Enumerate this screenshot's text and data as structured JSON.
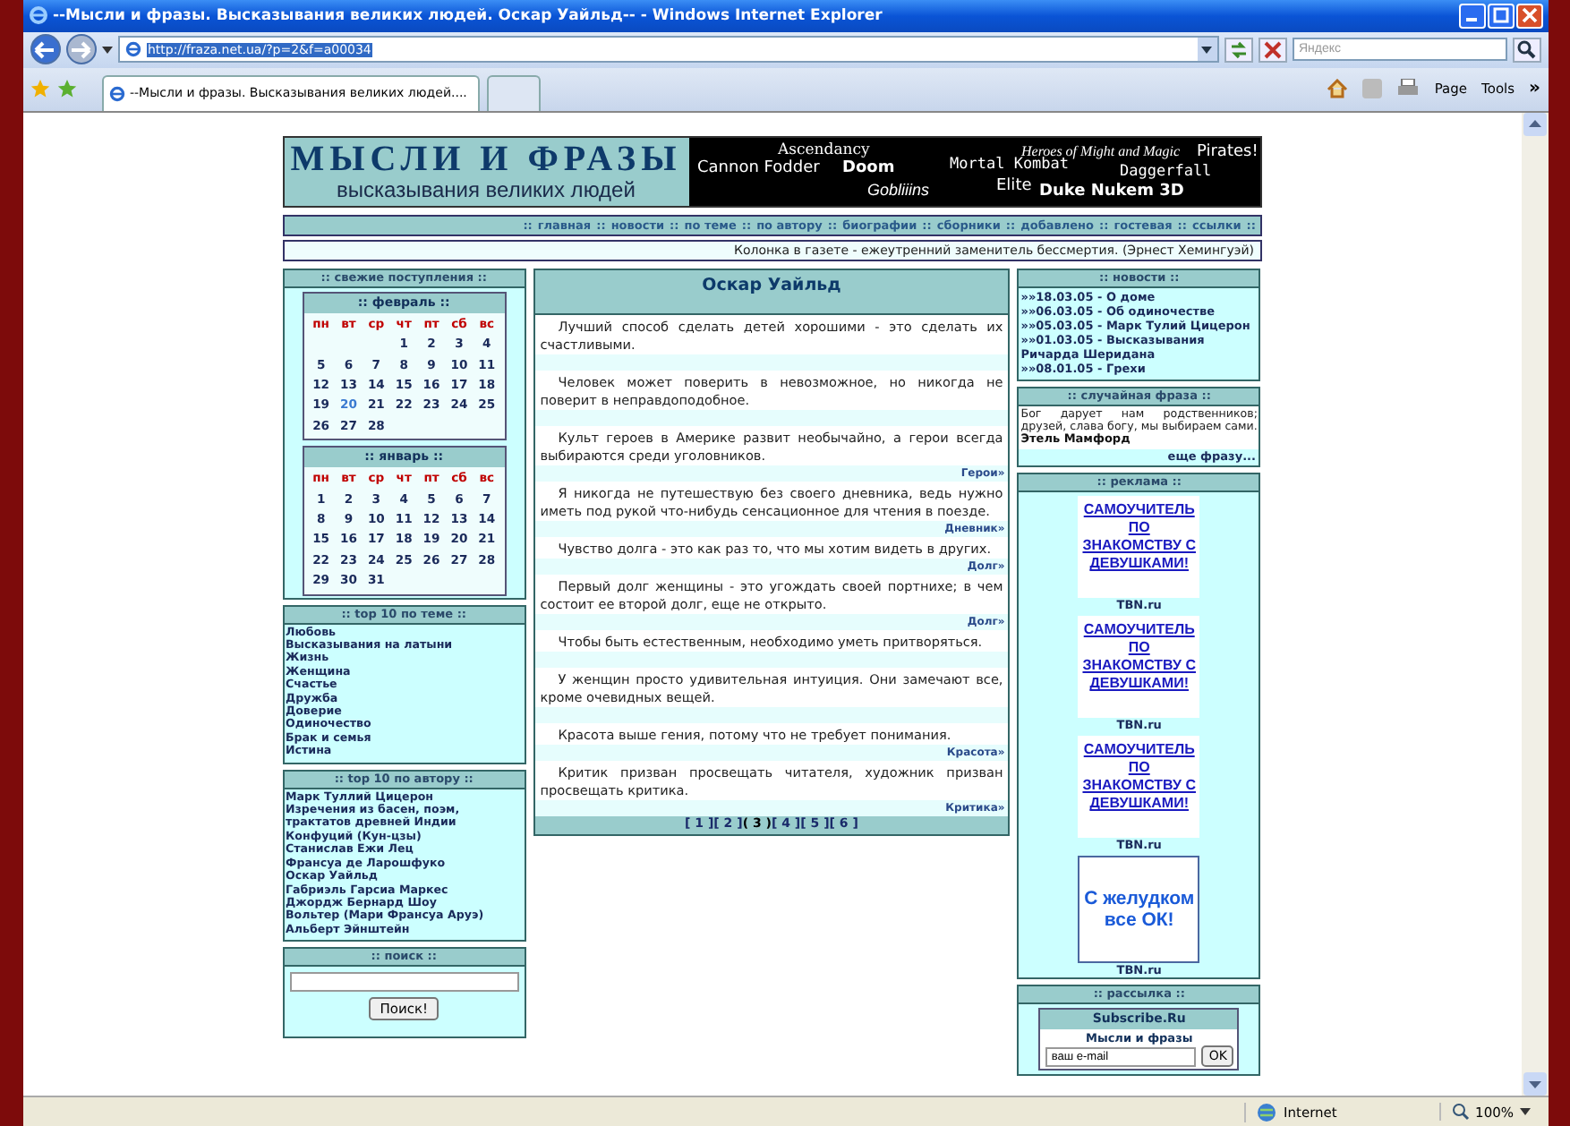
{
  "browser": {
    "title": "--Мысли и фразы. Высказывания великих людей. Оскар Уайльд-- - Windows Internet Explorer",
    "url": "http://fraza.net.ua/?p=2&f=a00034",
    "search_placeholder": "Яндекс",
    "tab_title": "--Мысли и фразы. Высказывания великих людей....",
    "menu": [
      "Page",
      "Tools"
    ],
    "overflow": "»"
  },
  "header": {
    "logo_title": "МЫСЛИ И ФРАЗЫ",
    "logo_subtitle": "высказывания великих людей",
    "games": [
      {
        "label": "Ascendancy",
        "kind": "serif"
      },
      {
        "label": "Heroes of Might and Magic",
        "kind": "serif-italic"
      },
      {
        "label": "Pirates!",
        "kind": "sans"
      },
      {
        "label": "Cannon Fodder",
        "kind": "sans"
      },
      {
        "label": "Doom",
        "kind": "bold"
      },
      {
        "label": "Mortal Kombat",
        "kind": "mono"
      },
      {
        "label": "Daggerfall",
        "kind": "mono"
      },
      {
        "label": "Gobliiins",
        "kind": "italic"
      },
      {
        "label": "Elite",
        "kind": "sans"
      },
      {
        "label": "Duke Nukem 3D",
        "kind": "bold"
      }
    ]
  },
  "nav": {
    "separator": "::",
    "links": [
      "главная",
      "новости",
      "по теме",
      "по автору",
      "биографии",
      "сборники",
      "добавлено",
      "гостевая",
      "ссылки"
    ]
  },
  "quote_bar": "Колонка в газете - ежеутренний заменитель бессмертия. (Эрнест Хемингуэй)",
  "left": {
    "fresh": {
      "title": ":: свежие поступления ::",
      "months": [
        {
          "title": ":: февраль ::",
          "weekdays": [
            "пн",
            "вт",
            "ср",
            "чт",
            "пт",
            "сб",
            "вс"
          ],
          "weeks": [
            [
              {
                "d": "1",
                "today": false
              },
              {
                "d": "2",
                "today": false
              },
              {
                "d": "3",
                "today": false
              },
              {
                "d": "4",
                "today": false
              }
            ],
            [
              {
                "d": "5",
                "today": false
              },
              {
                "d": "6",
                "today": false
              },
              {
                "d": "7",
                "today": false
              },
              {
                "d": "8",
                "today": false
              },
              {
                "d": "9",
                "today": false
              },
              {
                "d": "10",
                "today": false
              },
              {
                "d": "11",
                "today": false
              }
            ],
            [
              {
                "d": "12",
                "today": false
              },
              {
                "d": "13",
                "today": false
              },
              {
                "d": "14",
                "today": false
              },
              {
                "d": "15",
                "today": false
              },
              {
                "d": "16",
                "today": false
              },
              {
                "d": "17",
                "today": false
              },
              {
                "d": "18",
                "today": false
              }
            ],
            [
              {
                "d": "19",
                "today": false
              },
              {
                "d": "20",
                "today": true
              },
              {
                "d": "21",
                "today": false
              },
              {
                "d": "22",
                "today": false
              },
              {
                "d": "23",
                "today": false
              },
              {
                "d": "24",
                "today": false
              },
              {
                "d": "25",
                "today": false
              }
            ],
            [
              {
                "d": "26",
                "today": false
              },
              {
                "d": "27",
                "today": false
              },
              {
                "d": "28",
                "today": false
              }
            ]
          ]
        },
        {
          "title": ":: январь ::",
          "weekdays": [
            "пн",
            "вт",
            "ср",
            "чт",
            "пт",
            "сб",
            "вс"
          ],
          "weeks": [
            [
              {
                "d": "1",
                "today": false
              },
              {
                "d": "2",
                "today": false
              },
              {
                "d": "3",
                "today": false
              },
              {
                "d": "4",
                "today": false
              },
              {
                "d": "5",
                "today": false
              },
              {
                "d": "6",
                "today": false
              },
              {
                "d": "7",
                "today": false
              }
            ],
            [
              {
                "d": "8",
                "today": false
              },
              {
                "d": "9",
                "today": false
              },
              {
                "d": "10",
                "today": false
              },
              {
                "d": "11",
                "today": false
              },
              {
                "d": "12",
                "today": false
              },
              {
                "d": "13",
                "today": false
              },
              {
                "d": "14",
                "today": false
              }
            ],
            [
              {
                "d": "15",
                "today": false
              },
              {
                "d": "16",
                "today": false
              },
              {
                "d": "17",
                "today": false
              },
              {
                "d": "18",
                "today": false
              },
              {
                "d": "19",
                "today": false
              },
              {
                "d": "20",
                "today": false
              },
              {
                "d": "21",
                "today": false
              }
            ],
            [
              {
                "d": "22",
                "today": false
              },
              {
                "d": "23",
                "today": false
              },
              {
                "d": "24",
                "today": false
              },
              {
                "d": "25",
                "today": false
              },
              {
                "d": "26",
                "today": false
              },
              {
                "d": "27",
                "today": false
              },
              {
                "d": "28",
                "today": false
              }
            ],
            [
              {
                "d": "29",
                "today": false
              },
              {
                "d": "30",
                "today": false
              },
              {
                "d": "31",
                "today": false
              }
            ]
          ]
        }
      ]
    },
    "top_themes": {
      "title": ":: top 10 по теме ::",
      "items": [
        "Любовь",
        "Высказывания на латыни",
        "Жизнь",
        "Женщина",
        "Счастье",
        "Дружба",
        "Доверие",
        "Одиночество",
        "Брак и семья",
        "Истина"
      ]
    },
    "top_authors": {
      "title": ":: top 10 по автору ::",
      "items": [
        "Марк Туллий Цицерон",
        "Изречения из басен, поэм, трактатов древней Индии",
        "Конфуций (Кун-цзы)",
        "Станислав Ежи Лец",
        "Франсуа де Ларошфуко",
        "Оскар Уайльд",
        "Габриэль Гарсиа Маркес",
        "Джордж Бернард Шоу",
        "Вольтер (Мари Франсуа Аруэ)",
        "Альберт Эйнштейн"
      ]
    },
    "search": {
      "title": ":: поиск ::",
      "button": "Поиск!"
    }
  },
  "center": {
    "title": "Оскар Уайльд",
    "quotes": [
      {
        "text": "Лучший способ сделать детей хорошими - это сделать их счастливыми."
      },
      {
        "text": "Человек может поверить в невозможное, но никогда не поверит в неправдоподобное."
      },
      {
        "text": "Культ героев в Америке развит необычайно, а герои всегда выбираются среди уголовников.",
        "tag": "Герои»"
      },
      {
        "text": "Я никогда не путешествую без своего дневника, ведь нужно иметь под рукой что-нибудь сенсационное для чтения в поезде.",
        "tag": "Дневник»"
      },
      {
        "text": "Чувство долга - это как раз то, что мы хотим видеть в других.",
        "tag": "Долг»"
      },
      {
        "text": "Первый долг женщины - это угождать своей портнихе; в чем состоит ее второй долг, еще не открыто.",
        "tag": "Долг»"
      },
      {
        "text": "Чтобы быть естественным, необходимо уметь притворяться."
      },
      {
        "text": "У женщин просто удивительная интуиция. Они замечают все, кроме очевидных вещей."
      },
      {
        "text": "Красота выше гения, потому что не требует понимания.",
        "tag": "Красота»"
      },
      {
        "text": "Критик призван просвещать читателя, художник призван просвещать критика.",
        "tag": "Критика»"
      }
    ],
    "pages": [
      {
        "label": "[ 1 ]",
        "selected": false
      },
      {
        "label": "[ 2 ]",
        "selected": false
      },
      {
        "label": "( 3 )",
        "selected": true
      },
      {
        "label": "[ 4 ]",
        "selected": false
      },
      {
        "label": "[ 5 ]",
        "selected": false
      },
      {
        "label": "[ 6 ]",
        "selected": false
      }
    ]
  },
  "right": {
    "news": {
      "title": ":: новости ::",
      "items": [
        "»»18.03.05 - О доме",
        "»»06.03.05 - Об одиночестве",
        "»»05.03.05 - Марк Тулий Цицерон",
        "»»01.03.05 - Высказывания Ричарда Шеридана",
        "»»08.01.05 - Грехи"
      ]
    },
    "random": {
      "title": ":: случайная фраза ::",
      "text": "Бог дарует нам родственников; друзей, слава богу, мы выбираем сами.",
      "author": "Этель Мамфорд",
      "more": "еще фразу..."
    },
    "ads": {
      "title": ":: реклама ::",
      "items": [
        {
          "kind": "text",
          "text": "САМОУЧИТЕЛЬ ПО ЗНАКОМСТВУ С ДЕВУШКАМИ!",
          "source": "TBN.ru"
        },
        {
          "kind": "text",
          "text": "САМОУЧИТЕЛЬ ПО ЗНАКОМСТВУ С ДЕВУШКАМИ!",
          "source": "TBN.ru"
        },
        {
          "kind": "text",
          "text": "САМОУЧИТЕЛЬ ПО ЗНАКОМСТВУ С ДЕВУШКАМИ!",
          "source": "TBN.ru"
        },
        {
          "kind": "banner",
          "text": "С желудком все ОК!",
          "source": "TBN.ru"
        }
      ]
    },
    "mailing": {
      "title": ":: рассылка ::",
      "service": "Subscribe.Ru",
      "list_name": "Мысли и фразы",
      "email": "ваш e-mail",
      "button": "OK"
    }
  },
  "status_bar": {
    "zone": "Internet",
    "zoom": "100%"
  }
}
